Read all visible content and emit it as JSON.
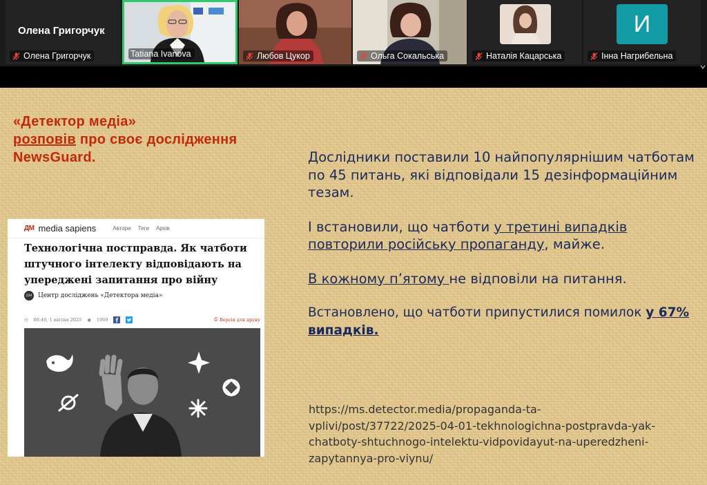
{
  "participants": [
    {
      "name": "Олена Григорчук",
      "display_name": "Олена Григорчук",
      "muted": true
    },
    {
      "name": "Tatiana Ivanova",
      "muted": false,
      "active_speaker": true
    },
    {
      "name": "Любов Цукор",
      "muted": true
    },
    {
      "name": "Ольга Сокальська",
      "muted": true
    },
    {
      "name": "Наталія Кацарська",
      "muted": true
    },
    {
      "name": "Інна Нагрибельна",
      "muted": true,
      "initial": "И"
    }
  ],
  "slide": {
    "title_line1": "«Детектор медіа»",
    "title_word_ul": "розповів",
    "title_rest": " про  своє дослідження NewsGuard.",
    "para1": "Дослідники поставили 10 найпопулярнішим чатботам по 45 питань, які відповідали 15 дезінформаційним тезам.",
    "para2_a": "І встановили, що чатботи ",
    "para2_ul": "у третині випадків повторили російську пропаганду",
    "para2_b": ", майже.",
    "para3_ul": "В кожному п’ятому ",
    "para3_b": "не відповіли на питання.",
    "para4_a": "Встановлено, що чатботи припустилися помилок ",
    "para4_bold": "у 67% випадків.",
    "url": "https://ms.detector.media/propaganda-ta-vplivi/post/37722/2025-04-01-tekhnologichna-postpravda-yak-chatboty-shtuchnogo-intelektu-vidpovidayut-na-uperedzheni-zapytannya-pro-viynu/"
  },
  "article": {
    "logo_dm": "ДМ",
    "logo_ms": "media sapiens",
    "nav": [
      "Автори",
      "Теги",
      "Архів"
    ],
    "title": "Технологічна постправда. Як чатботи штучного інтелекту відповідають на упереджені запитання про війну",
    "author": "Центр досліджень «Детектора медіа»",
    "author_badge": "ДМ",
    "date": "08:40, 1 квітня 2025",
    "views": "1969",
    "print_label": "Версія для друку"
  },
  "colors": {
    "slide_title": "#c0290b",
    "slide_text": "#1b2a5a",
    "active_border": "#2fc96a",
    "avatar_bg": "#119ca5"
  }
}
